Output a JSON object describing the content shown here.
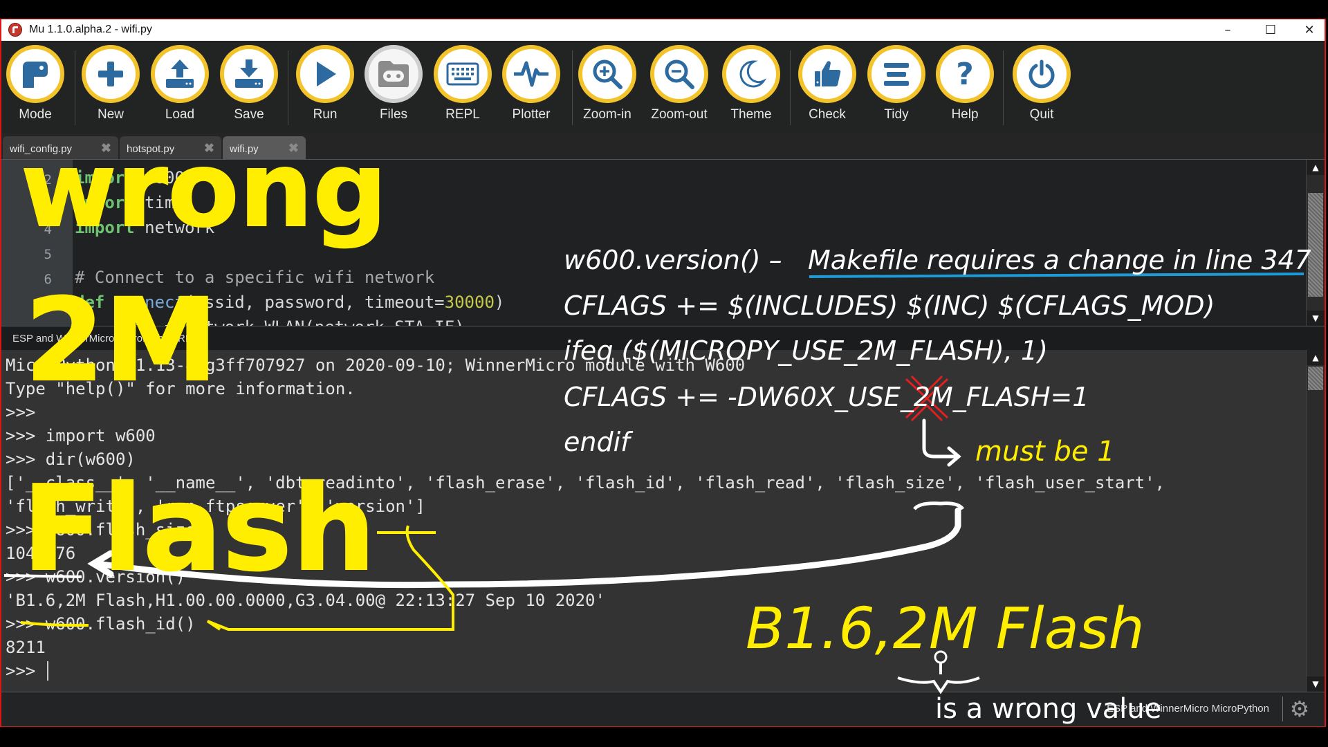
{
  "window": {
    "title": "Mu 1.1.0.alpha.2 - wifi.py",
    "controls": {
      "minimize": "–",
      "maximize": "☐",
      "close": "✕"
    }
  },
  "toolbar": {
    "buttons": [
      {
        "id": "mode",
        "label": "Mode",
        "icon": "mode-icon"
      },
      {
        "id": "new",
        "label": "New",
        "icon": "plus-icon"
      },
      {
        "id": "load",
        "label": "Load",
        "icon": "upload-icon"
      },
      {
        "id": "save",
        "label": "Save",
        "icon": "download-icon"
      },
      {
        "id": "run",
        "label": "Run",
        "icon": "play-icon"
      },
      {
        "id": "files",
        "label": "Files",
        "icon": "files-icon",
        "disabled": true
      },
      {
        "id": "repl",
        "label": "REPL",
        "icon": "keyboard-icon"
      },
      {
        "id": "plotter",
        "label": "Plotter",
        "icon": "pulse-icon"
      },
      {
        "id": "zoom-in",
        "label": "Zoom-in",
        "icon": "zoom-in-icon"
      },
      {
        "id": "zoom-out",
        "label": "Zoom-out",
        "icon": "zoom-out-icon"
      },
      {
        "id": "theme",
        "label": "Theme",
        "icon": "moon-icon"
      },
      {
        "id": "check",
        "label": "Check",
        "icon": "thumbs-up-icon"
      },
      {
        "id": "tidy",
        "label": "Tidy",
        "icon": "tidy-icon"
      },
      {
        "id": "help",
        "label": "Help",
        "icon": "question-icon"
      },
      {
        "id": "quit",
        "label": "Quit",
        "icon": "power-icon"
      }
    ],
    "accent_color": "#f2c32a",
    "icon_color": "#2d6aa0"
  },
  "tabs": [
    {
      "label": "wifi_config.py",
      "active": false
    },
    {
      "label": "hotspot.py",
      "active": false
    },
    {
      "label": "wifi.py",
      "active": true
    }
  ],
  "editor": {
    "lines": [
      {
        "n": "2",
        "kw": "import",
        "rest": " w600"
      },
      {
        "n": "3",
        "kw": "import",
        "rest": " time"
      },
      {
        "n": "4",
        "kw": "import",
        "rest": " network"
      },
      {
        "n": "5",
        "kw": "",
        "rest": ""
      },
      {
        "n": "6",
        "comment": "# Connect to a specific wifi network"
      },
      {
        "n": "7",
        "kw": "def",
        "fn": " connect",
        "args": "(essid, password, timeout=",
        "num": "30000",
        "close": ")"
      },
      {
        "n": "8",
        "rest": "    wifi = network.WLAN(network.STA_IF)"
      }
    ]
  },
  "repl": {
    "title": "ESP and WinnerMicro MicroPython REPL",
    "lines": [
      "MicroPython v1.13-4-g3ff707927 on 2020-09-10; WinnerMicro module with W600",
      "Type \"help()\" for more information.",
      ">>>",
      ">>> import w600",
      ">>> dir(w600)",
      "['__class__', '__name__', 'dbt_readinto', 'flash_erase', 'flash_id', 'flash_read', 'flash_size', 'flash_user_start',",
      "'flash_write', 'run_ftpserver', 'version']",
      ">>> w600.flash_size()",
      "1048576",
      ">>> w600.version()",
      "'B1.6,2M Flash,H1.00.00.0000,G3.04.00@ 22:13:27 Sep 10 2020'",
      ">>> w600.flash_id()",
      "8211",
      ">>> "
    ]
  },
  "status": {
    "mode": "ESP and WinnerMicro MicroPython",
    "gear_icon": "gear-icon"
  },
  "annotations": {
    "overlay_big": [
      "wrong",
      "2M",
      "Flash"
    ],
    "makefile_title_left": "w600.version()  –",
    "makefile_title_right": "Makefile requires a change in line 347",
    "makefile_lines": [
      "CFLAGS += $(INCLUDES) $(INC) $(CFLAGS_MOD)",
      "ifeq ($(MICROPY_USE_2M_FLASH), 1)",
      "CFLAGS += -DW60X_USE_2M_FLASH=1",
      "endif"
    ],
    "must_be": "must be 1",
    "version_highlight": "B1.6,2M Flash",
    "wrong_value": "is a wrong value",
    "colors": {
      "yellow": "#ffee00",
      "white": "#ffffff",
      "underline_blue": "#1e9ad6",
      "cross_red": "#e02020"
    }
  }
}
